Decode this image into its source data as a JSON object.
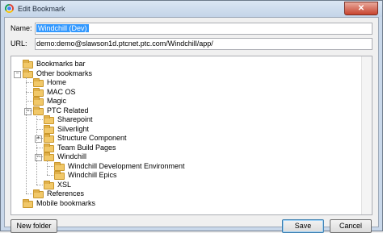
{
  "window": {
    "title": "Edit Bookmark",
    "close_glyph": "✕"
  },
  "form": {
    "name_label": "Name:",
    "name_value": "Windchill (Dev)",
    "url_label": "URL:",
    "url_value": "demo:demo@slawson1d.ptcnet.ptc.com/Windchill/app/"
  },
  "tree": {
    "items": [
      {
        "label": "Bookmarks bar",
        "level": 1,
        "expander": ""
      },
      {
        "label": "Other bookmarks",
        "level": 1,
        "expander": "−"
      },
      {
        "label": "Home",
        "level": 2,
        "expander": ""
      },
      {
        "label": "MAC OS",
        "level": 2,
        "expander": ""
      },
      {
        "label": "Magic",
        "level": 2,
        "expander": ""
      },
      {
        "label": "PTC Related",
        "level": 2,
        "expander": "−"
      },
      {
        "label": "Sharepoint",
        "level": 3,
        "expander": ""
      },
      {
        "label": "Silverlight",
        "level": 3,
        "expander": ""
      },
      {
        "label": "Structure Component",
        "level": 3,
        "expander": "+"
      },
      {
        "label": "Team Build Pages",
        "level": 3,
        "expander": ""
      },
      {
        "label": "Windchill",
        "level": 3,
        "expander": "−"
      },
      {
        "label": "Windchill Development Environment",
        "level": 4,
        "expander": ""
      },
      {
        "label": "Windchill Epics",
        "level": 4,
        "expander": ""
      },
      {
        "label": "XSL",
        "level": 3,
        "expander": ""
      },
      {
        "label": "References",
        "level": 2,
        "expander": ""
      },
      {
        "label": "Mobile bookmarks",
        "level": 1,
        "expander": ""
      }
    ]
  },
  "buttons": {
    "new_folder": "New folder",
    "save": "Save",
    "cancel": "Cancel"
  },
  "colors": {
    "selection": "#3399ff",
    "folder": "#f1c869",
    "close": "#c7442f"
  }
}
